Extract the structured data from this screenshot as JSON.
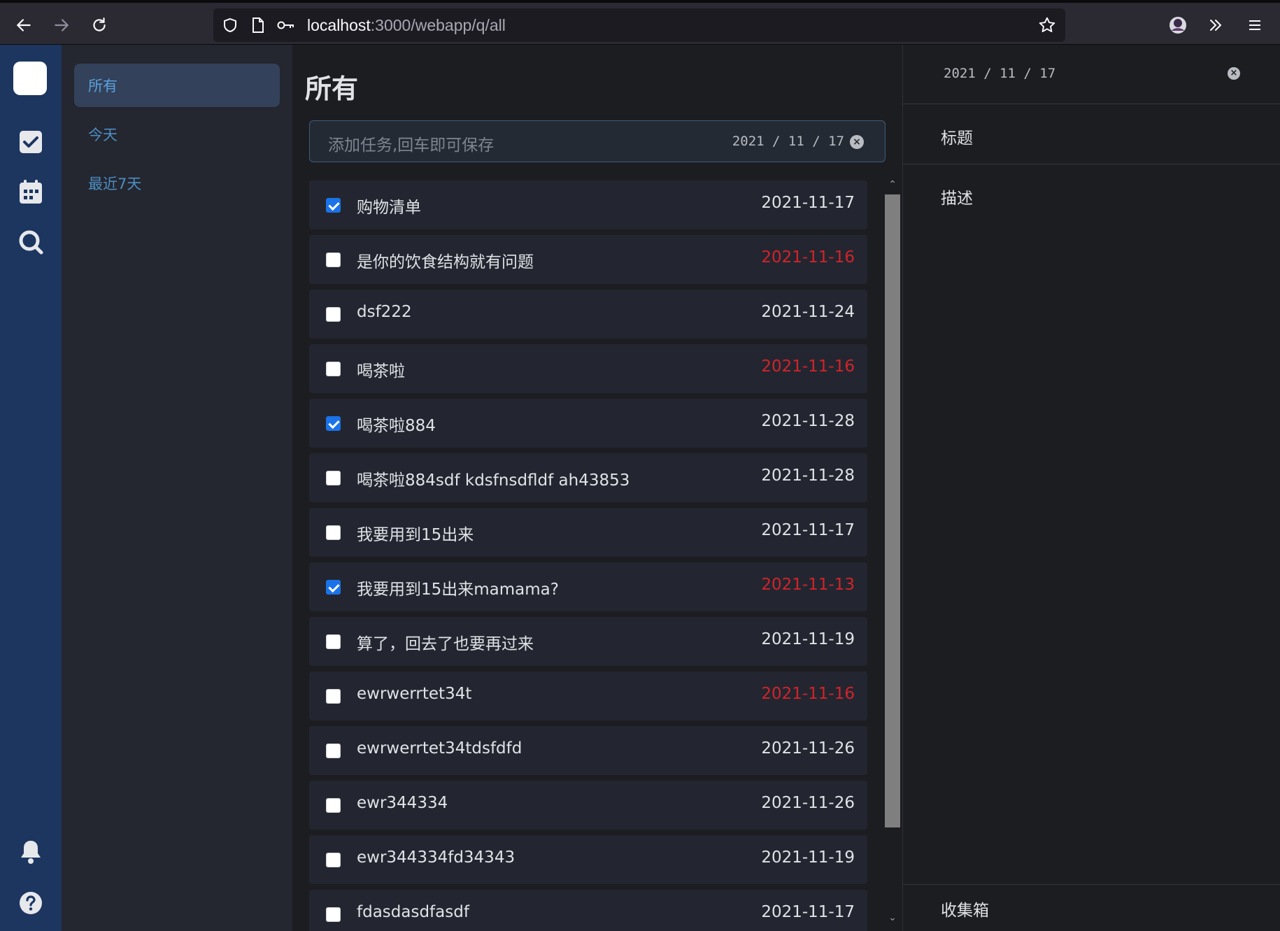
{
  "browser": {
    "url_host": "localhost",
    "url_rest": ":3000/webapp/q/all"
  },
  "sidebar": {
    "items": [
      {
        "label": "所有"
      },
      {
        "label": "今天"
      },
      {
        "label": "最近7天"
      }
    ]
  },
  "main": {
    "title": "所有",
    "add_input": {
      "placeholder": "添加任务,回车即可保存",
      "date": "2021 / 11 / 17"
    },
    "tasks": [
      {
        "title": "购物清单",
        "due": "2021-11-17",
        "done": true,
        "overdue": false
      },
      {
        "title": "是你的饮食结构就有问题",
        "due": "2021-11-16",
        "done": false,
        "overdue": true
      },
      {
        "title": "dsf222",
        "due": "2021-11-24",
        "done": false,
        "overdue": false
      },
      {
        "title": "喝茶啦",
        "due": "2021-11-16",
        "done": false,
        "overdue": true
      },
      {
        "title": "喝茶啦884",
        "due": "2021-11-28",
        "done": true,
        "overdue": false
      },
      {
        "title": "喝茶啦884sdf kdsfnsdfldf ah43853",
        "due": "2021-11-28",
        "done": false,
        "overdue": false
      },
      {
        "title": "我要用到15出来",
        "due": "2021-11-17",
        "done": false,
        "overdue": false
      },
      {
        "title": "我要用到15出来mamama?",
        "due": "2021-11-13",
        "done": true,
        "overdue": true
      },
      {
        "title": "算了，回去了也要再过来",
        "due": "2021-11-19",
        "done": false,
        "overdue": false
      },
      {
        "title": "ewrwerrtet34t",
        "due": "2021-11-16",
        "done": false,
        "overdue": true
      },
      {
        "title": "ewrwerrtet34tdsfdfd",
        "due": "2021-11-26",
        "done": false,
        "overdue": false
      },
      {
        "title": "ewr344334",
        "due": "2021-11-26",
        "done": false,
        "overdue": false
      },
      {
        "title": "ewr344334fd34343",
        "due": "2021-11-19",
        "done": false,
        "overdue": false
      },
      {
        "title": "fdasdasdfasdf",
        "due": "2021-11-17",
        "done": false,
        "overdue": false
      }
    ]
  },
  "detail": {
    "date": "2021 / 11 / 17",
    "title_label": "标题",
    "description_label": "描述",
    "list_label": "收集箱"
  },
  "colors": {
    "rail": "#1d3660",
    "accent": "#5aa0de",
    "overdue": "#d2232a",
    "checked": "#1a73e8"
  }
}
